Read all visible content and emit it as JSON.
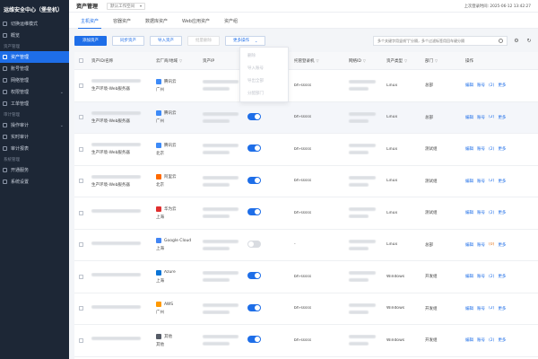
{
  "sidebar": {
    "brand": "运维安全中心（堡垒机）",
    "items": [
      {
        "label": "切换运维模式",
        "section": false
      },
      {
        "label": "概览",
        "section": false
      }
    ],
    "sections": [
      {
        "title": "资产管理",
        "items": [
          {
            "label": "资产管理",
            "active": true
          },
          {
            "label": "账号管理"
          },
          {
            "label": "网络管理"
          },
          {
            "label": "权限管理",
            "chev": "⌄"
          },
          {
            "label": "工单管理"
          }
        ]
      },
      {
        "title": "审计管理",
        "items": [
          {
            "label": "操作审计",
            "chev": "⌄"
          },
          {
            "label": "实时审计"
          },
          {
            "label": "审计报表"
          }
        ]
      },
      {
        "title": "系统管理",
        "items": [
          {
            "label": "开通服务"
          },
          {
            "label": "系统设置"
          }
        ]
      }
    ]
  },
  "header": {
    "title": "资产管理",
    "workspace": "默认工作空间",
    "login": "上次登录时间: 2025-06-12 13:42:27"
  },
  "tabs": [
    "主机资产",
    "容器资产",
    "数据库资产",
    "Web应用资产",
    "资产组"
  ],
  "toolbar": {
    "add_host": "添加资产",
    "sync_assets": "同步资产",
    "import_assets": "导入资产",
    "batch_delete": "批量删除",
    "more_ops": "更多操作",
    "search_placeholder": "多个关键字用竖线\"|\"分隔，多个过滤标签用回车键分隔"
  },
  "menu": [
    "删除",
    "导入账号",
    "导出全部",
    "分配部门"
  ],
  "table": {
    "headers": [
      "资产ID/名称",
      "云厂商/地域",
      "资产IP",
      "托管登录机",
      "网络ID",
      "资产类型",
      "部门",
      "操作"
    ],
    "rows": [
      {
        "name": "生产环境-Web服务器",
        "cloud": "腾讯云",
        "region": "广州",
        "logo_color": "#3d8af7",
        "toggle": "off_hidden",
        "mgr": "bh-sssss",
        "os": "Linux",
        "dept": "总部",
        "hl": false
      },
      {
        "name": "生产环境-Web服务器",
        "cloud": "腾讯云",
        "region": "广州",
        "logo_color": "#3d8af7",
        "toggle": "on",
        "mgr": "bh-sssss",
        "os": "Linux",
        "dept": "总部",
        "hl": true
      },
      {
        "name": "生产环境-Web服务器",
        "cloud": "腾讯云",
        "region": "北京",
        "logo_color": "#3d8af7",
        "toggle": "on",
        "mgr": "bh-sssss",
        "os": "Linux",
        "dept": "测试组",
        "hl": false
      },
      {
        "name": "生产环境-Web服务器",
        "cloud": "阿里云",
        "region": "北京",
        "logo_color": "#ff6a00",
        "toggle": "on",
        "mgr": "bh-sssss",
        "os": "Linux",
        "dept": "测试组",
        "hl": false
      },
      {
        "name": "",
        "cloud": "华为云",
        "region": "上海",
        "logo_color": "#e02f2f",
        "toggle": "on",
        "mgr": "bh-sssss",
        "os": "Linux",
        "dept": "测试组",
        "hl": false
      },
      {
        "name": "",
        "cloud": "Google Cloud",
        "region": "上海",
        "logo_color": "#4285f4",
        "toggle": "off",
        "mgr": "-",
        "os": "Linux",
        "dept": "总部",
        "hl": false
      },
      {
        "name": "",
        "cloud": "Azure",
        "region": "上海",
        "logo_color": "#0a74d6",
        "toggle": "on",
        "mgr": "bh-sssss",
        "os": "Windows",
        "dept": "开发组",
        "hl": false
      },
      {
        "name": "",
        "cloud": "AWS",
        "region": "广州",
        "logo_color": "#ff9900",
        "toggle": "on",
        "mgr": "bh-sssss",
        "os": "Windows",
        "dept": "开发组",
        "hl": false
      },
      {
        "name": "",
        "cloud": "其他",
        "region": "其他",
        "logo_color": "#555b66",
        "toggle": "on",
        "mgr": "bh-sssss",
        "os": "Windows",
        "dept": "开发组",
        "hl": false
      }
    ],
    "ops": [
      "编辑",
      "账号",
      "(2)",
      "更多"
    ],
    "ops_warn": [
      "编辑",
      "账号",
      "(0)",
      "更多"
    ]
  },
  "colors": {
    "accent": "#1e6ee8",
    "sidebar_bg": "#1d2736"
  }
}
